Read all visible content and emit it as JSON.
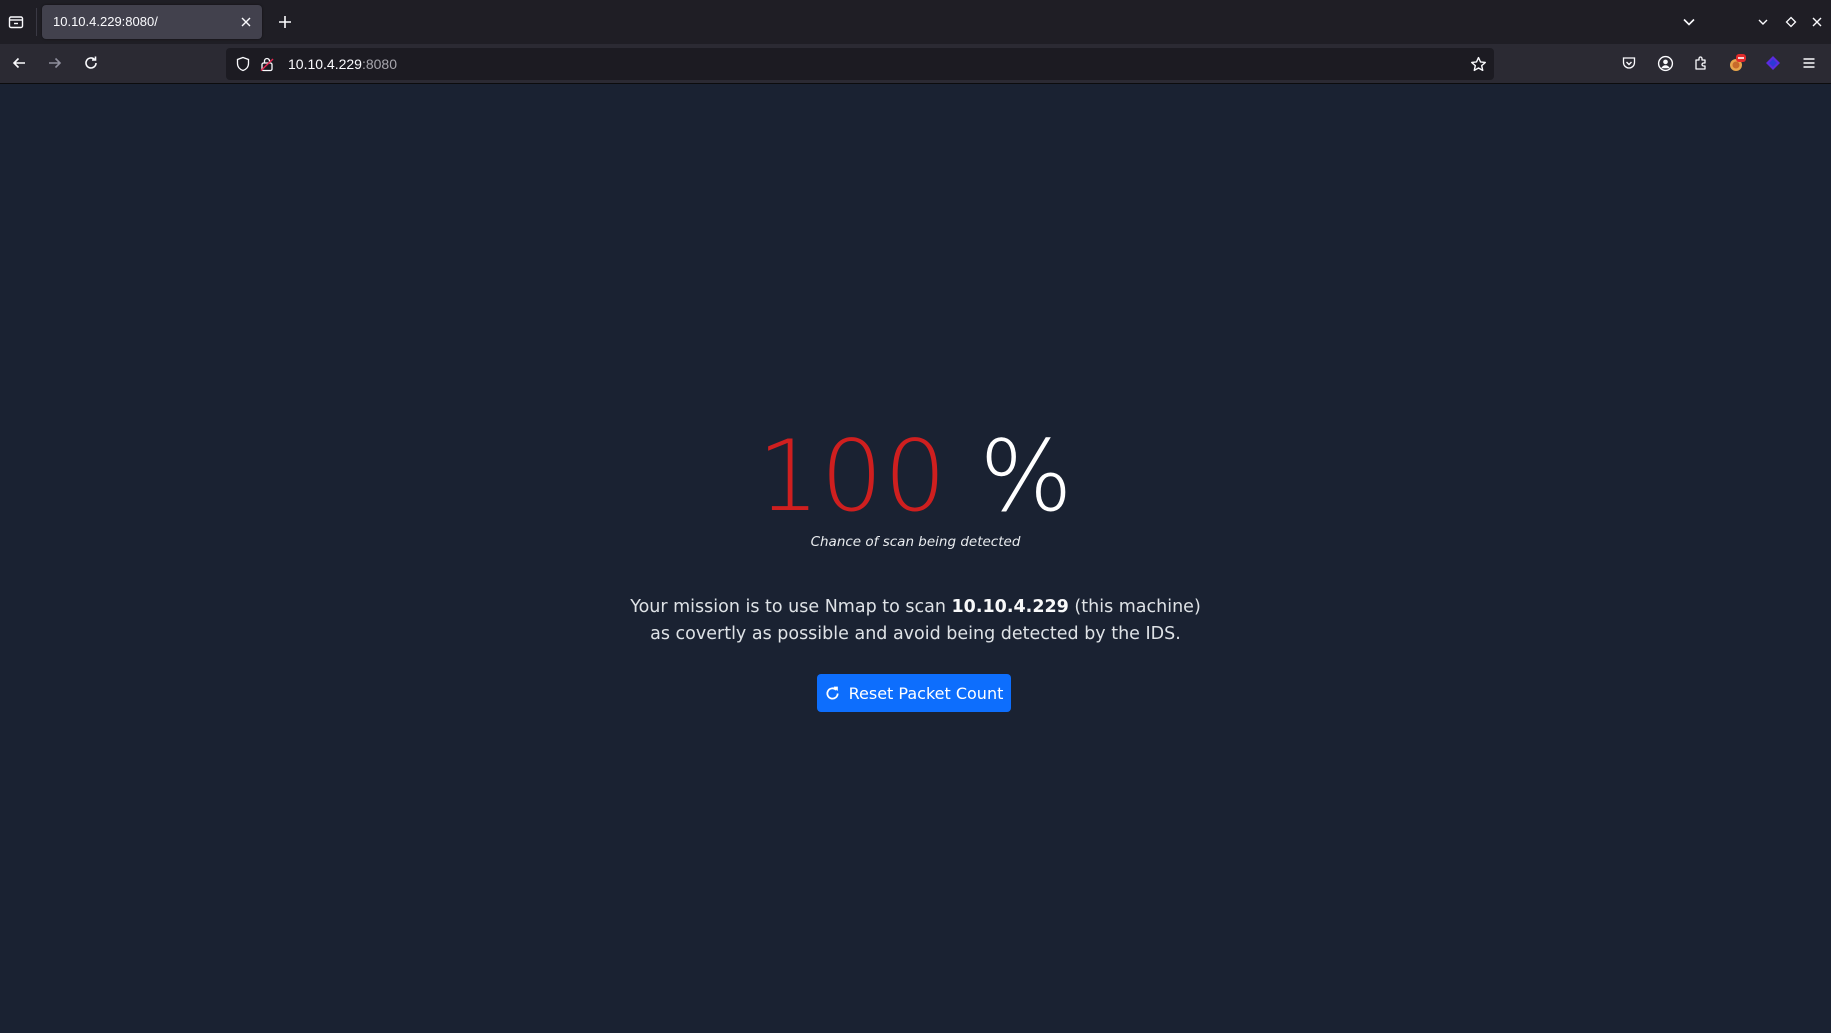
{
  "browser": {
    "tab": {
      "title": "10.10.4.229:8080/"
    },
    "url": {
      "host": "10.10.4.229",
      "port": ":8080"
    }
  },
  "page": {
    "detection": {
      "value": "100",
      "unit": "%",
      "caption": "Chance of scan being detected"
    },
    "mission": {
      "prefix": "Your mission is to use Nmap to scan ",
      "target": "10.10.4.229",
      "suffix": " (this machine)",
      "line2": "as covertly as possible and avoid being detected by the IDS."
    },
    "reset_button": {
      "label": "Reset Packet Count"
    }
  },
  "colors": {
    "background": "#1a2232",
    "danger": "#cf1f1f",
    "primary": "#0d6efd"
  }
}
